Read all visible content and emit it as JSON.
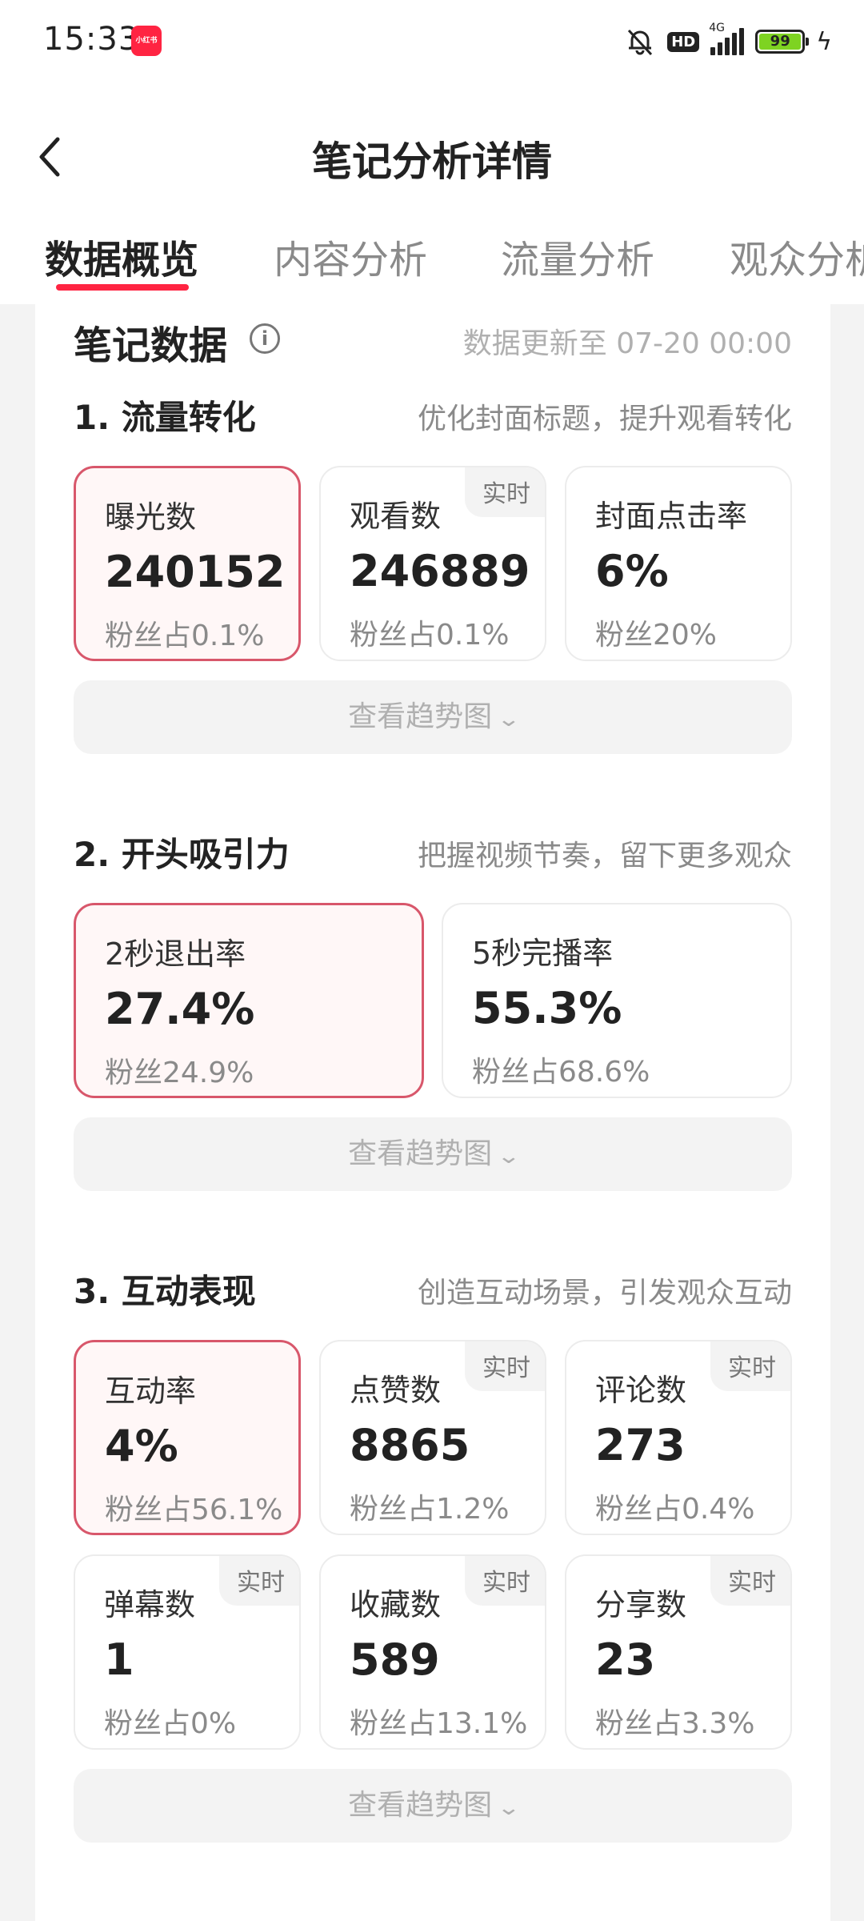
{
  "status_bar": {
    "time": "15:33",
    "app_badge": "小红书",
    "hd": "HD",
    "network": "4G",
    "battery": "99",
    "charging_icon": "bolt-icon"
  },
  "nav": {
    "title": "笔记分析详情"
  },
  "tabs": [
    {
      "label": "数据概览"
    },
    {
      "label": "内容分析"
    },
    {
      "label": "流量分析"
    },
    {
      "label": "观众分析"
    }
  ],
  "note_data": {
    "title": "笔记数据",
    "update_text": "数据更新至 07-20 00:00"
  },
  "sections": [
    {
      "title": "1. 流量转化",
      "hint": "优化封面标题，提升观看转化",
      "metrics": [
        {
          "label": "曝光数",
          "value": "240152",
          "sub": "粉丝占0.1%",
          "realtime": ""
        },
        {
          "label": "观看数",
          "value": "246889",
          "sub": "粉丝占0.1%",
          "realtime": "实时"
        },
        {
          "label": "封面点击率",
          "value": "6%",
          "sub": "粉丝20%",
          "realtime": ""
        }
      ],
      "trend": "查看趋势图"
    },
    {
      "title": "2. 开头吸引力",
      "hint": "把握视频节奏，留下更多观众",
      "metrics": [
        {
          "label": "2秒退出率",
          "value": "27.4%",
          "sub": "粉丝24.9%",
          "realtime": ""
        },
        {
          "label": "5秒完播率",
          "value": "55.3%",
          "sub": "粉丝占68.6%",
          "realtime": ""
        }
      ],
      "trend": "查看趋势图"
    },
    {
      "title": "3. 互动表现",
      "hint": "创造互动场景，引发观众互动",
      "metrics": [
        {
          "label": "互动率",
          "value": "4%",
          "sub": "粉丝占56.1%",
          "realtime": ""
        },
        {
          "label": "点赞数",
          "value": "8865",
          "sub": "粉丝占1.2%",
          "realtime": "实时"
        },
        {
          "label": "评论数",
          "value": "273",
          "sub": "粉丝占0.4%",
          "realtime": "实时"
        },
        {
          "label": "弹幕数",
          "value": "1",
          "sub": "粉丝占0%",
          "realtime": "实时"
        },
        {
          "label": "收藏数",
          "value": "589",
          "sub": "粉丝占13.1%",
          "realtime": "实时"
        },
        {
          "label": "分享数",
          "value": "23",
          "sub": "粉丝占3.3%",
          "realtime": "实时"
        }
      ],
      "trend": "查看趋势图"
    }
  ],
  "colors": {
    "accent": "#ff2442",
    "selected_border": "#d8576b",
    "selected_bg": "#fff7f7"
  }
}
